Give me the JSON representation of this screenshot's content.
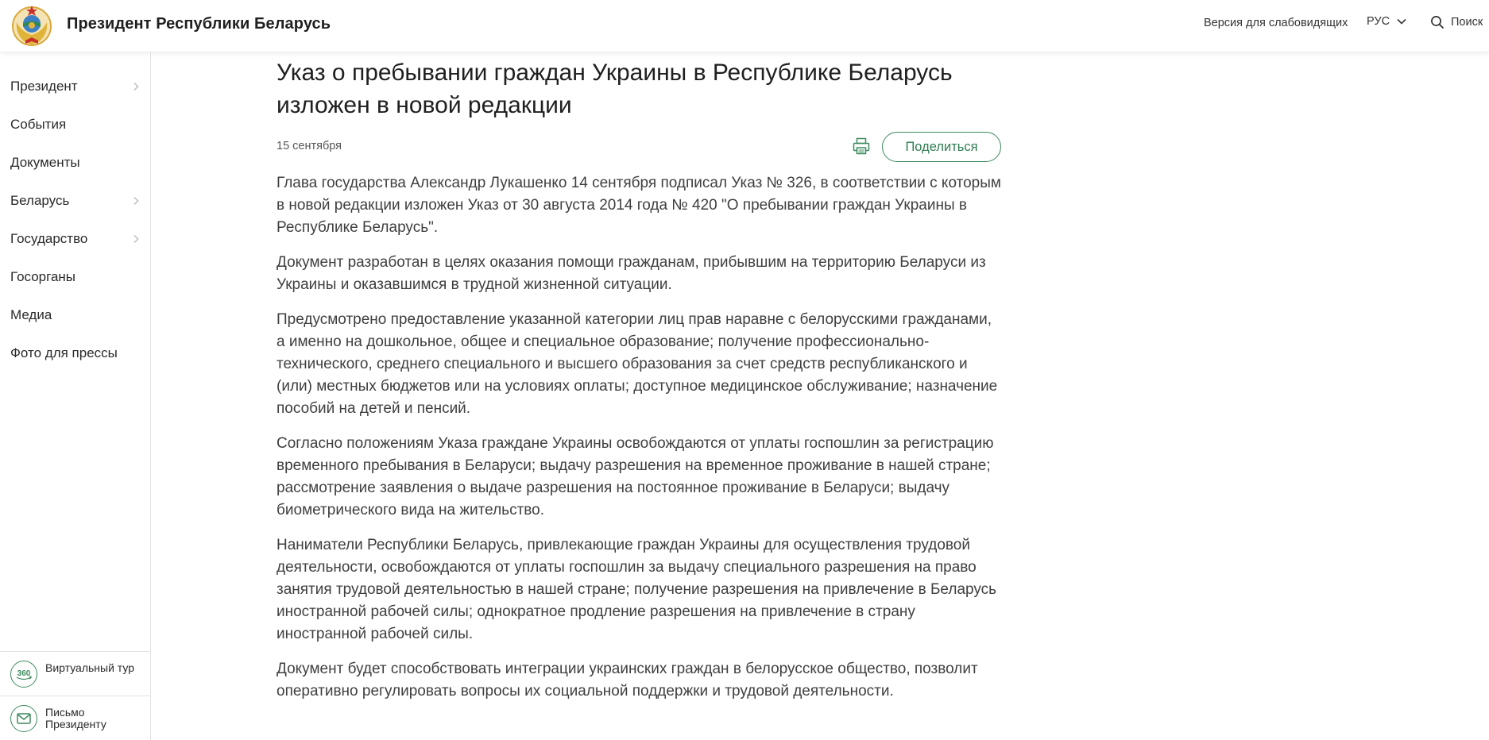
{
  "header": {
    "site_title": "Президент Республики Беларусь",
    "accessibility_link": "Версия для слабовидящих",
    "language": "РУС",
    "search_label": "Поиск"
  },
  "sidebar": {
    "items": [
      {
        "label": "Президент",
        "has_submenu": true
      },
      {
        "label": "События",
        "has_submenu": false
      },
      {
        "label": "Документы",
        "has_submenu": false
      },
      {
        "label": "Беларусь",
        "has_submenu": true
      },
      {
        "label": "Государство",
        "has_submenu": true
      },
      {
        "label": "Госорганы",
        "has_submenu": false
      },
      {
        "label": "Медиа",
        "has_submenu": false
      },
      {
        "label": "Фото для прессы",
        "has_submenu": false
      }
    ],
    "virtual_tour": {
      "icon_text": "360",
      "label": "Виртуальный тур"
    },
    "letter": {
      "label": "Письмо Президенту"
    }
  },
  "article": {
    "title": "Указ о пребывании граждан Украины в Республике Беларусь изложен в новой редакции",
    "date": "15 сентября",
    "share_label": "Поделиться",
    "paragraphs": [
      "Глава государства Александр Лукашенко 14 сентября подписал Указ № 326, в соответствии с которым в новой редакции изложен Указ от 30 августа 2014 года № 420 \"О пребывании граждан Украины в Республике Беларусь\".",
      "Документ разработан в целях оказания помощи гражданам, прибывшим на территорию Беларуси из Украины и оказавшимся в трудной жизненной ситуации.",
      "Предусмотрено предоставление указанной категории лиц прав наравне с белорусскими гражданами, а именно на дошкольное, общее и специальное образование; получение профессионально-технического, среднего специального и высшего образования за счет средств республиканского и (или) местных бюджетов или на условиях оплаты; доступное медицинское обслуживание; назначение пособий на детей и пенсий.",
      "Согласно положениям Указа граждане Украины освобождаются от уплаты госпошлин за регистрацию временного пребывания в Беларуси; выдачу разрешения на временное проживание в нашей стране; рассмотрение заявления о выдаче разрешения на постоянное проживание в Беларуси; выдачу биометрического вида на жительство.",
      "Наниматели Республики Беларусь, привлекающие граждан Украины для осуществления трудовой деятельности, освобождаются от уплаты госпошлин за выдачу специального разрешения на право занятия трудовой деятельностью в нашей стране; получение разрешения на привлечение в Беларусь иностранной рабочей силы; однократное продление разрешения на привлечение в страну иностранной рабочей силы.",
      "Документ будет способствовать интеграции украинских граждан в белорусское общество, позволит оперативно регулировать вопросы их социальной поддержки и трудовой деятельности."
    ]
  },
  "colors": {
    "accent_green": "#3d8a5e",
    "emblem_gold": "#e0b43a",
    "emblem_red": "#c8302c",
    "emblem_green": "#2f8a4a"
  }
}
